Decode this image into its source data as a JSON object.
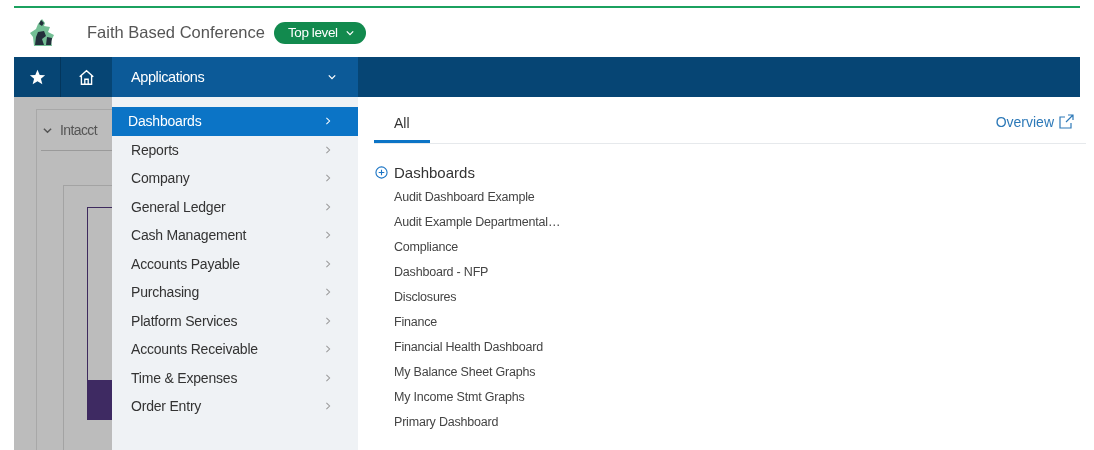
{
  "header": {
    "title": "Faith Based Conference",
    "level_pill": "Top level"
  },
  "nav": {
    "menu_label": "Applications"
  },
  "background_panel": {
    "tab_title": "Intacct"
  },
  "menu": [
    {
      "label": "Dashboards",
      "selected": true
    },
    {
      "label": "Reports",
      "selected": false
    },
    {
      "label": "Company",
      "selected": false
    },
    {
      "label": "General Ledger",
      "selected": false
    },
    {
      "label": "Cash Management",
      "selected": false
    },
    {
      "label": "Accounts Payable",
      "selected": false
    },
    {
      "label": "Purchasing",
      "selected": false
    },
    {
      "label": "Platform Services",
      "selected": false
    },
    {
      "label": "Accounts Receivable",
      "selected": false
    },
    {
      "label": "Time & Expenses",
      "selected": false
    },
    {
      "label": "Order Entry",
      "selected": false
    }
  ],
  "tabs": [
    {
      "label": "All",
      "selected": true
    }
  ],
  "overview_link": "Overview",
  "section": {
    "title": "Dashboards",
    "items": [
      "Audit Dashboard Example",
      "Audit Example Departmental…",
      "Compliance",
      "Dashboard - NFP",
      "Disclosures",
      "Finance",
      "Financial Health Dashboard",
      "My Balance Sheet Graphs",
      "My Income Stmt Graphs",
      "Primary Dashboard"
    ]
  }
}
